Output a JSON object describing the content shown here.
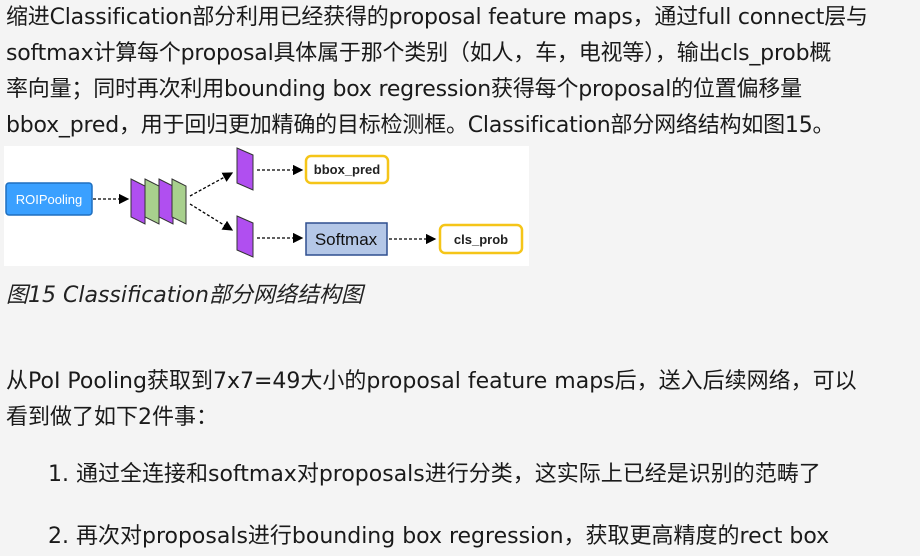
{
  "paragraph1": {
    "lines": [
      "缩进Classification部分利用已经获得的proposal feature maps，通过full connect层与",
      "softmax计算每个proposal具体属于那个类别（如人，车，电视等），输出cls_prob概",
      "率向量；同时再次利用bounding box regression获得每个proposal的位置偏移量",
      "bbox_pred，用于回归更加精确的目标检测框。Classification部分网络结构如图15。"
    ]
  },
  "figure": {
    "input_label": "ROIPooling",
    "output_top_label": "bbox_pred",
    "softmax_label": "Softmax",
    "output_bottom_label": "cls_prob",
    "colors": {
      "roi_fill": "#3aa0ff",
      "purple": "#b04ff0",
      "green": "#a8d08d",
      "yellow_border": "#f5c518",
      "softmax_fill": "#b4c7e7",
      "softmax_border": "#2f4f8f"
    }
  },
  "caption": "图15 Classification部分网络结构图",
  "paragraph2": {
    "lines": [
      "从PoI Pooling获取到7x7=49大小的proposal feature maps后，送入后续网络，可以",
      "看到做了如下2件事："
    ]
  },
  "list": [
    "1. 通过全连接和softmax对proposals进行分类，这实际上已经是识别的范畴了",
    "2. 再次对proposals进行bounding box regression，获取更高精度的rect box"
  ]
}
